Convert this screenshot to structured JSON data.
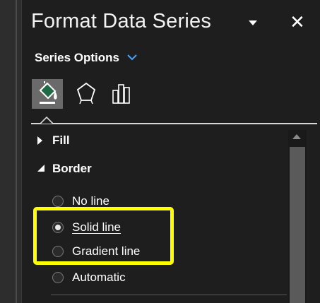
{
  "pane": {
    "title": "Format Data Series",
    "close_label": "✕"
  },
  "options_menu": {
    "label": "Series Options"
  },
  "tabs": [
    {
      "icon": "fill-line-icon",
      "selected": true
    },
    {
      "icon": "effects-pentagon-icon",
      "selected": false
    },
    {
      "icon": "series-options-bars-icon",
      "selected": false
    }
  ],
  "sections": {
    "fill": {
      "label": "Fill",
      "expanded": false
    },
    "border": {
      "label": "Border",
      "expanded": true
    }
  },
  "border_options": [
    {
      "label": "No line",
      "checked": false
    },
    {
      "label": "Solid line",
      "checked": true
    },
    {
      "label": "Gradient line",
      "checked": false
    },
    {
      "label": "Automatic",
      "checked": false
    }
  ],
  "colors": {
    "background": "#1e1e1e",
    "highlight": "#ffff00",
    "selected_tab": "#6a6a6a",
    "fill_icon_green": "#1e6b45"
  }
}
